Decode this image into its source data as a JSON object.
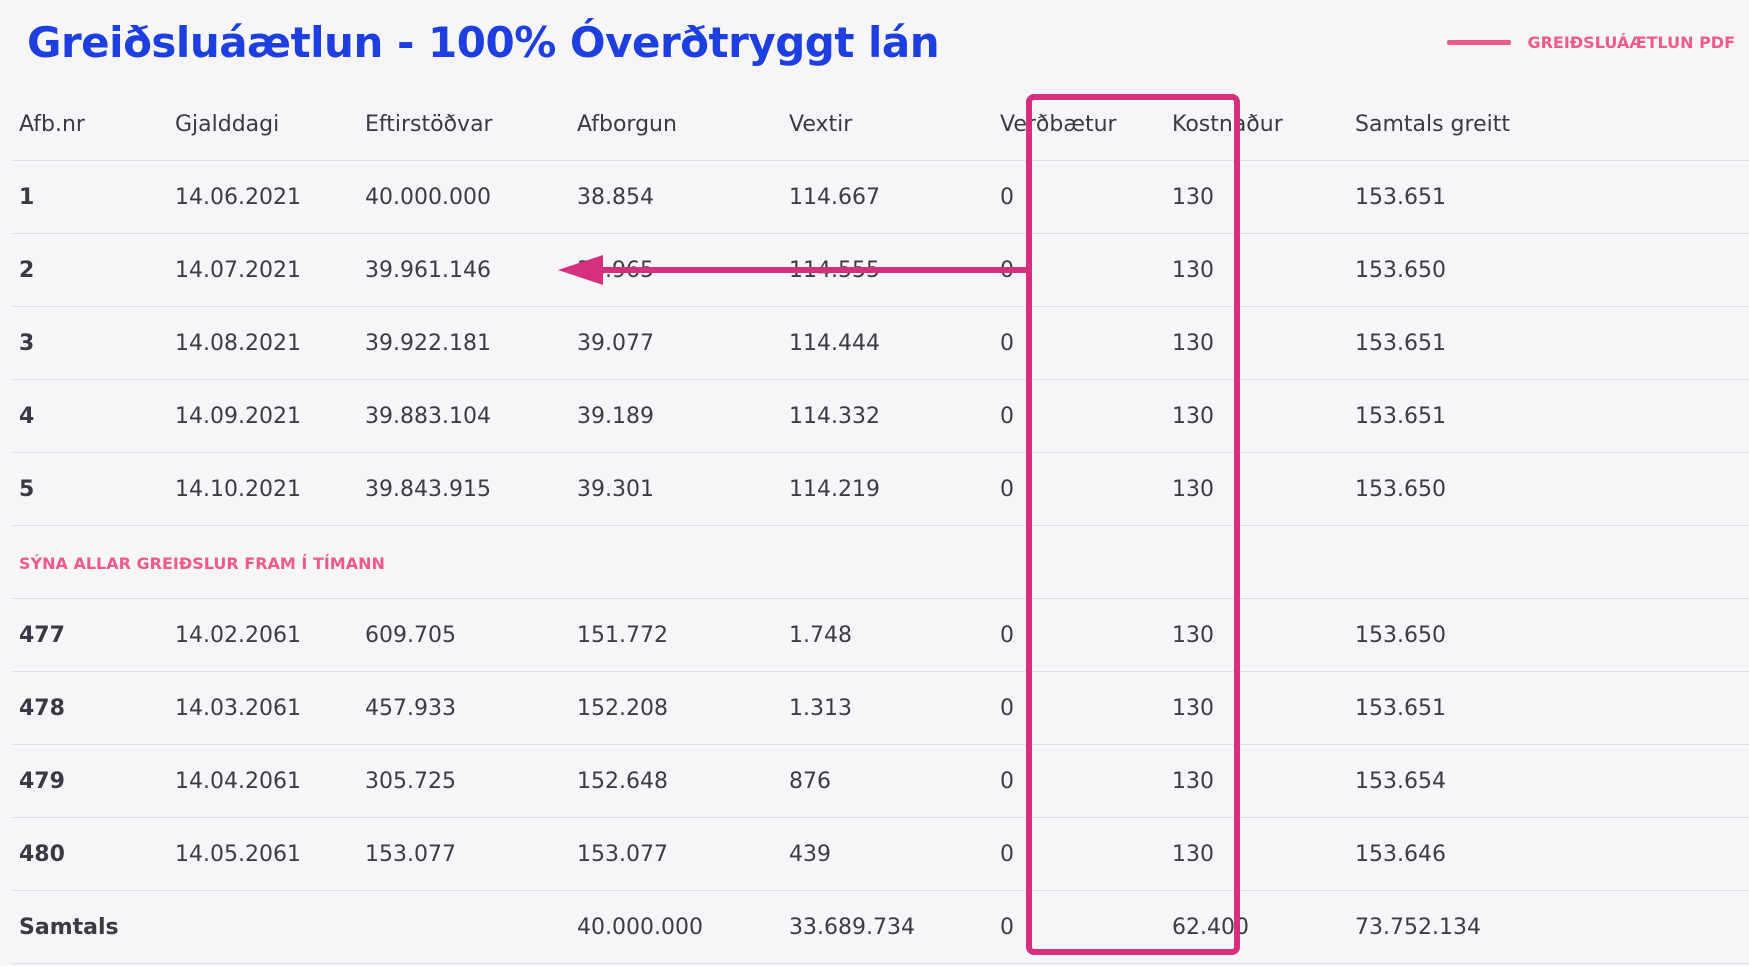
{
  "header": {
    "title": "Greiðsluáætlun - 100% Óverðtryggt lán",
    "pdf_link_label": "GREIÐSLUÁÆTLUN PDF"
  },
  "table": {
    "columns": [
      "Afb.nr",
      "Gjalddagi",
      "Eftirstöðvar",
      "Afborgun",
      "Vextir",
      "Verðbætur",
      "Kostnaður",
      "Samtals greitt"
    ],
    "rows_first": [
      [
        "1",
        "14.06.2021",
        "40.000.000",
        "38.854",
        "114.667",
        "0",
        "130",
        "153.651"
      ],
      [
        "2",
        "14.07.2021",
        "39.961.146",
        "38.965",
        "114.555",
        "0",
        "130",
        "153.650"
      ],
      [
        "3",
        "14.08.2021",
        "39.922.181",
        "39.077",
        "114.444",
        "0",
        "130",
        "153.651"
      ],
      [
        "4",
        "14.09.2021",
        "39.883.104",
        "39.189",
        "114.332",
        "0",
        "130",
        "153.651"
      ],
      [
        "5",
        "14.10.2021",
        "39.843.915",
        "39.301",
        "114.219",
        "0",
        "130",
        "153.650"
      ]
    ],
    "show_all_label": "SÝNA ALLAR GREIÐSLUR FRAM Í TÍMANN",
    "rows_last": [
      [
        "477",
        "14.02.2061",
        "609.705",
        "151.772",
        "1.748",
        "0",
        "130",
        "153.650"
      ],
      [
        "478",
        "14.03.2061",
        "457.933",
        "152.208",
        "1.313",
        "0",
        "130",
        "153.651"
      ],
      [
        "479",
        "14.04.2061",
        "305.725",
        "152.648",
        "876",
        "0",
        "130",
        "153.654"
      ],
      [
        "480",
        "14.05.2061",
        "153.077",
        "153.077",
        "439",
        "0",
        "130",
        "153.646"
      ]
    ],
    "totals": {
      "label": "Samtals",
      "gjalddagi": "",
      "eftirstodvar": "",
      "afborgun": "40.000.000",
      "vextir": "33.689.734",
      "verdbaetur": "0",
      "kostnadur": "62.400",
      "samtals": "73.752.134"
    }
  },
  "colors": {
    "title": "#1d3fe0",
    "link_pink": "#ee5a8a",
    "annotation_magenta": "#d62f7e",
    "background": "#f6f6f9"
  }
}
